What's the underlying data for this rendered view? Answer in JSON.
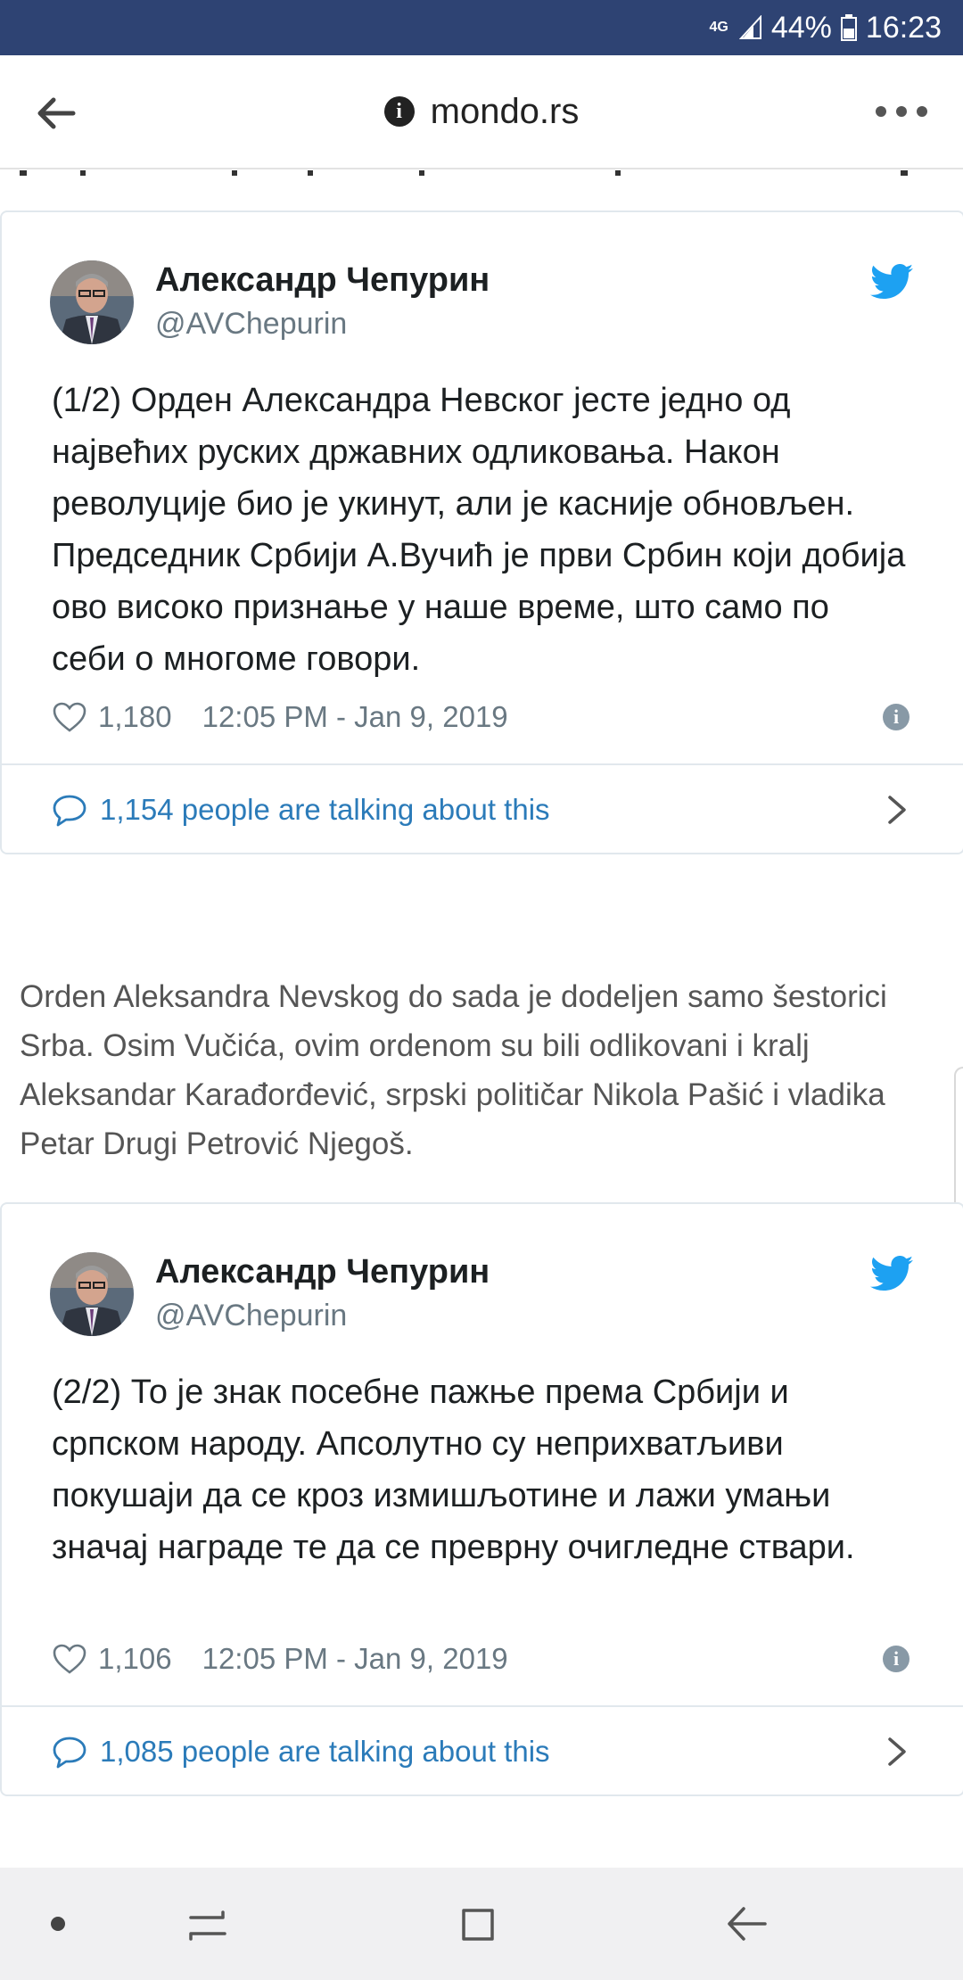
{
  "status_bar": {
    "network": "4G",
    "battery": "44%",
    "time": "16:23"
  },
  "browser": {
    "url": "mondo.rs"
  },
  "tweets": [
    {
      "name": "Александр Чепурин",
      "handle": "@AVChepurin",
      "text": "(1/2) Орден Александра Невског јесте једно од највећих руских државних одликовања. Након револуције био је укинут, али је касније обновљен. Председник Србији А.Вучић је први Србин који добија ово високо признање у наше време, што само по себи о многоме говори.",
      "likes": "1,180",
      "timestamp": "12:05 PM - Jan 9, 2019",
      "talking": "1,154 people are talking about this"
    },
    {
      "name": "Александр Чепурин",
      "handle": "@AVChepurin",
      "text": "(2/2) То је знак посебне пажње према Србији и српском народу. Апсолутно су неприхватљиви покушаји да се кроз измишљотине и лажи умањи значај награде те да се преврну очигледне ствари.",
      "likes": "1,106",
      "timestamp": "12:05 PM - Jan 9, 2019",
      "talking": "1,085 people are talking about this"
    }
  ],
  "article": {
    "paragraph": "Orden Aleksandra Nevskog do sada je dodeljen samo šestorici Srba. Osim Vučića, ovim ordenom su bili odlikovani i kralj Aleksandar Karađorđević, srpski političar Nikola Pašić i vladika Petar Drugi Petrović Njegoš."
  },
  "colors": {
    "status_bar": "#2e4373",
    "twitter_blue": "#1da1f2",
    "link_blue": "#2b7bb9",
    "muted_gray": "#697882"
  },
  "icons": {
    "back": "arrow-left-icon",
    "info": "info-icon",
    "menu": "more-dots-icon",
    "bird": "twitter-bird-icon",
    "like": "heart-icon",
    "talk": "comment-bubble-icon",
    "chevron": "chevron-right-icon"
  }
}
